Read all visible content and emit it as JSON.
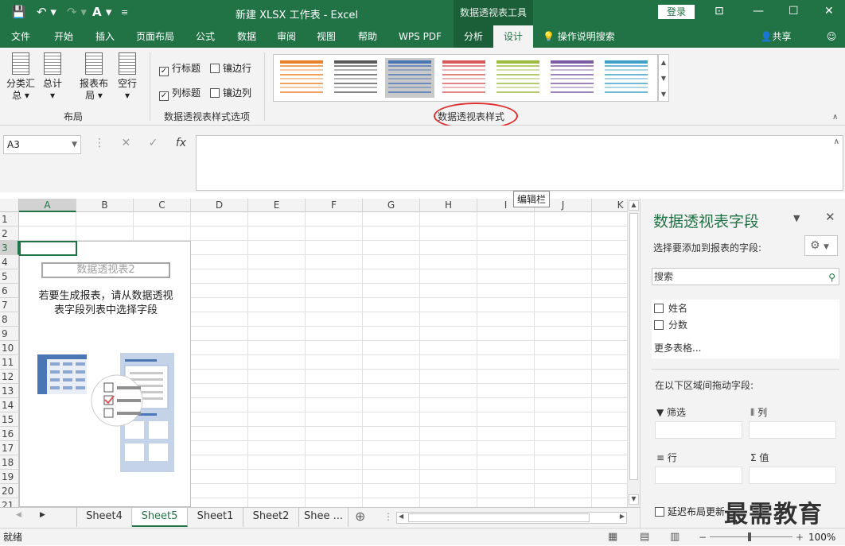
{
  "title": {
    "doc_name": "新建 XLSX 工作表",
    "app": "Excel",
    "context_tools": "数据透视表工具",
    "login": "登录"
  },
  "icons": {
    "save": "save-icon",
    "undo": "undo-icon",
    "redo": "redo-icon",
    "font_color": "font-color-icon",
    "customize": "customize-icon"
  },
  "tabs": [
    {
      "label": "文件"
    },
    {
      "label": "开始"
    },
    {
      "label": "插入"
    },
    {
      "label": "页面布局"
    },
    {
      "label": "公式"
    },
    {
      "label": "数据"
    },
    {
      "label": "审阅"
    },
    {
      "label": "视图"
    },
    {
      "label": "帮助"
    },
    {
      "label": "WPS PDF"
    },
    {
      "label": "分析"
    },
    {
      "label": "设计"
    }
  ],
  "tell_me": "操作说明搜索",
  "share": "共享",
  "ribbon": {
    "layout_buttons": [
      {
        "line1": "分类汇",
        "line2": "总 ▾"
      },
      {
        "line1": "总计",
        "line2": "▾"
      },
      {
        "line1": "报表布",
        "line2": "局 ▾"
      },
      {
        "line1": "空行",
        "line2": "▾"
      }
    ],
    "layout_group": "布局",
    "options": [
      {
        "label": "行标题",
        "checked": "✓"
      },
      {
        "label": "镶边行",
        "checked": ""
      },
      {
        "label": "列标题",
        "checked": "✓"
      },
      {
        "label": "镶边列",
        "checked": ""
      }
    ],
    "options_group": "数据透视表样式选项",
    "styles_group": "数据透视表样式",
    "style_colors": [
      "#e9812a",
      "#595959",
      "#4a76b5",
      "#d9595b",
      "#9bbb3c",
      "#7b5aa6",
      "#3e9fc8"
    ],
    "selected_style": 2
  },
  "formula": {
    "cell_ref": "A3",
    "fx": "fx",
    "tooltip": "编辑栏"
  },
  "columns": [
    "A",
    "B",
    "C",
    "D",
    "E",
    "F",
    "G",
    "H",
    "I",
    "J",
    "K"
  ],
  "rows": [
    "1",
    "2",
    "3",
    "4",
    "5",
    "6",
    "7",
    "8",
    "9",
    "10",
    "11",
    "12",
    "13",
    "14",
    "15",
    "16",
    "17",
    "18",
    "19",
    "20",
    "21"
  ],
  "pivot": {
    "title": "数据透视表2",
    "line1": "若要生成报表，请从数据透视",
    "line2": "表字段列表中选择字段"
  },
  "sheets": [
    "Sheet4",
    "Sheet5",
    "Sheet1",
    "Sheet2",
    "Shee ..."
  ],
  "active_sheet": "Sheet5",
  "status": {
    "ready": "就绪",
    "zoom": "100%"
  },
  "panel": {
    "title": "数据透视表字段",
    "subtitle": "选择要添加到报表的字段:",
    "search_placeholder": "搜索",
    "fields": [
      {
        "label": "姓名"
      },
      {
        "label": "分数"
      }
    ],
    "more_tables": "更多表格...",
    "drag_hint": "在以下区域间拖动字段:",
    "areas": {
      "filter": "筛选",
      "columns": "列",
      "rows": "行",
      "values": "值"
    },
    "defer": "延迟布局更新"
  },
  "watermark": "最需教育"
}
